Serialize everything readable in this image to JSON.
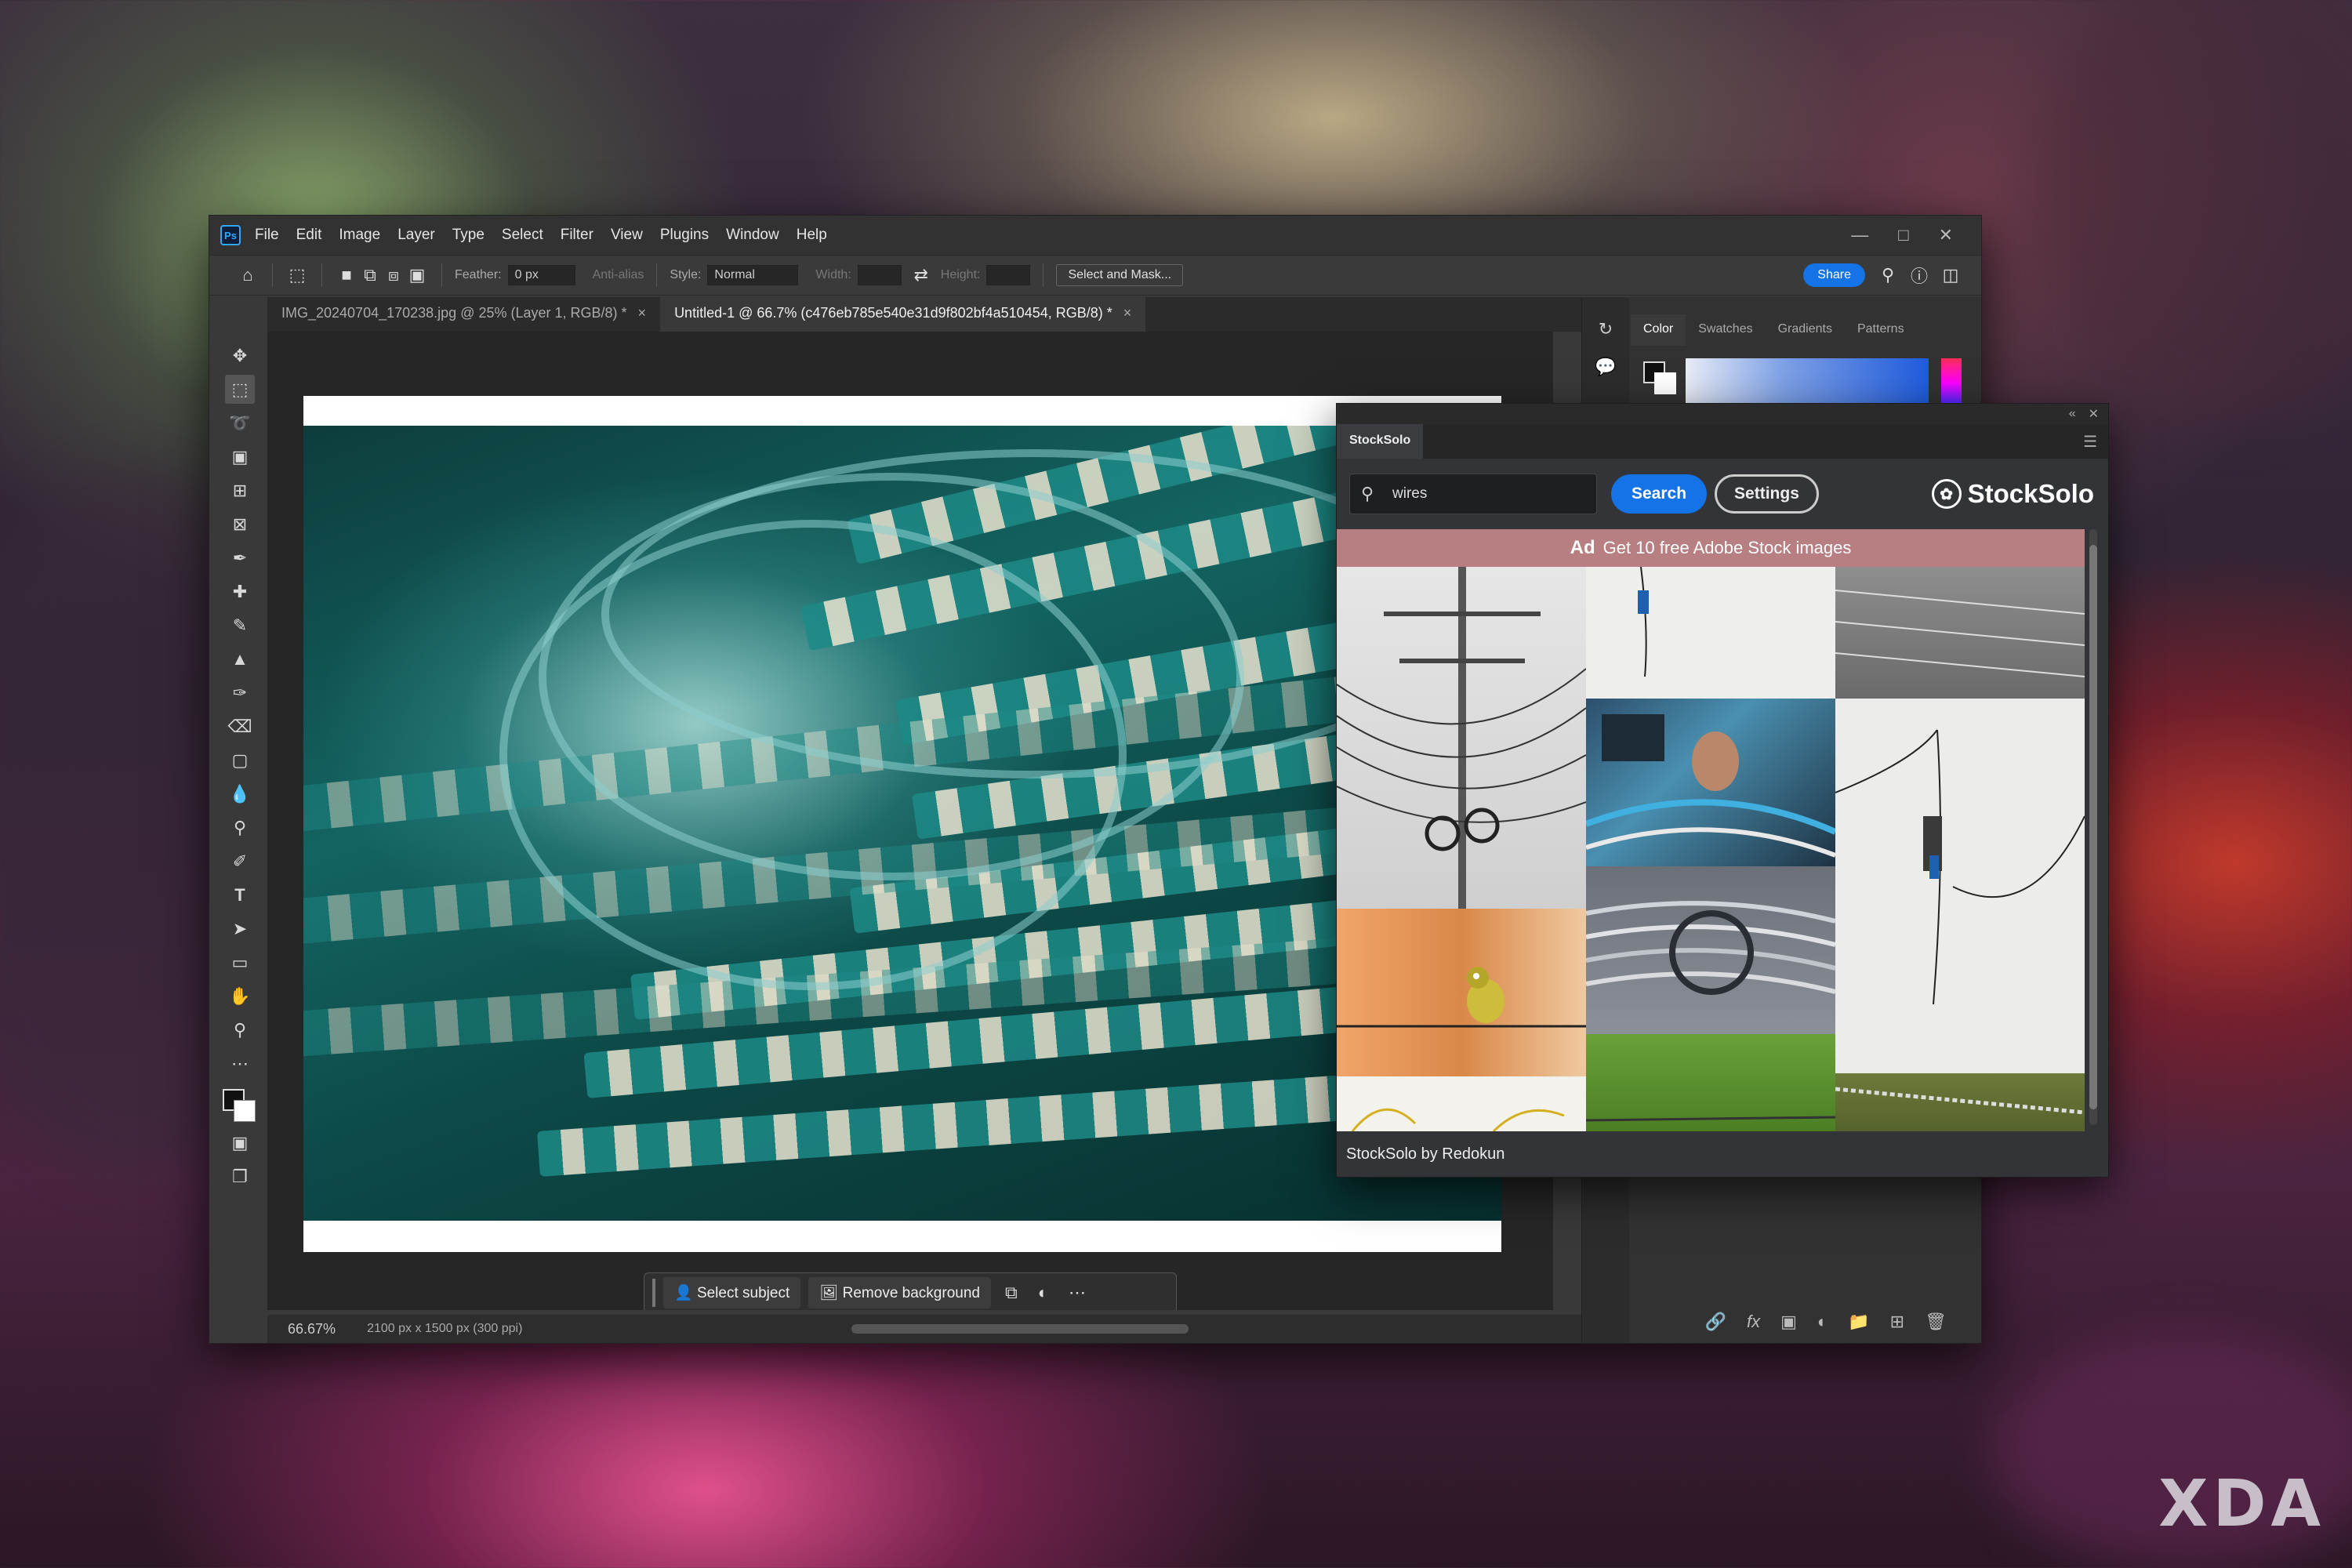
{
  "menubar": {
    "app_logo": "Ps",
    "items": [
      "File",
      "Edit",
      "Image",
      "Layer",
      "Type",
      "Select",
      "Filter",
      "View",
      "Plugins",
      "Window",
      "Help"
    ]
  },
  "options": {
    "feather_label": "Feather:",
    "feather_value": "0 px",
    "antialias_label": "Anti-alias",
    "style_label": "Style:",
    "style_value": "Normal",
    "width_label": "Width:",
    "height_label": "Height:",
    "select_mask_label": "Select and Mask...",
    "share_label": "Share"
  },
  "tabs": [
    {
      "label": "IMG_20240704_170238.jpg @ 25% (Layer 1, RGB/8) *",
      "active": false
    },
    {
      "label": "Untitled-1 @ 66.7% (c476eb785e540e31d9f802bf4a510454, RGB/8) *",
      "active": true
    }
  ],
  "context_bar": {
    "select_subject": "Select subject",
    "remove_background": "Remove background"
  },
  "status": {
    "zoom": "66.67%",
    "dimensions": "2100 px x 1500 px (300 ppi)"
  },
  "panels": {
    "tabs": [
      "Color",
      "Swatches",
      "Gradients",
      "Patterns"
    ]
  },
  "stocksolo": {
    "tab_label": "StockSolo",
    "search_value": "wires",
    "search_button": "Search",
    "settings_button": "Settings",
    "brand": "StockSolo",
    "ad_label": "Ad",
    "ad_text": "Get 10 free Adobe Stock images",
    "footer": "StockSolo by Redokun"
  },
  "watermark": "XDA",
  "colors": {
    "accent": "#1473e6",
    "ad_banner": "#b77f81",
    "ps_bg": "#393939"
  }
}
